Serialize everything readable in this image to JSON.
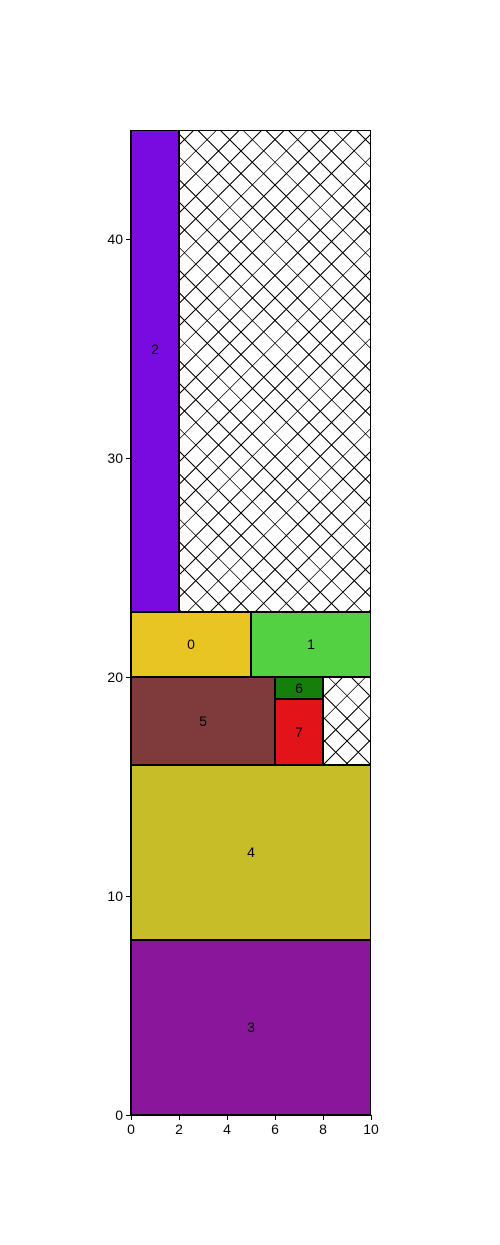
{
  "chart_data": {
    "type": "treemap-rects",
    "xlim": [
      0,
      10
    ],
    "ylim": [
      0,
      45
    ],
    "title": "",
    "xlabel": "",
    "ylabel": "",
    "xticks": [
      0,
      2,
      4,
      6,
      8,
      10
    ],
    "yticks": [
      0,
      10,
      20,
      30,
      40
    ],
    "rects": [
      {
        "id": "0",
        "label": "0",
        "x0": 0,
        "x1": 5,
        "y0": 20,
        "y1": 23,
        "fill": "#e8c522",
        "hatch": false
      },
      {
        "id": "1",
        "label": "1",
        "x0": 5,
        "x1": 10,
        "y0": 20,
        "y1": 23,
        "fill": "#54d043",
        "hatch": false
      },
      {
        "id": "2",
        "label": "2",
        "x0": 0,
        "x1": 2,
        "y0": 23,
        "y1": 45,
        "fill": "#7a0be0",
        "hatch": false
      },
      {
        "id": "h2",
        "label": "",
        "x0": 2,
        "x1": 10,
        "y0": 23,
        "y1": 45,
        "fill": "#ffffff",
        "hatch": true
      },
      {
        "id": "3",
        "label": "3",
        "x0": 0,
        "x1": 10,
        "y0": 0,
        "y1": 8,
        "fill": "#8a169b",
        "hatch": false
      },
      {
        "id": "4",
        "label": "4",
        "x0": 0,
        "x1": 10,
        "y0": 8,
        "y1": 16,
        "fill": "#c7bd29",
        "hatch": false
      },
      {
        "id": "5",
        "label": "5",
        "x0": 0,
        "x1": 6,
        "y0": 16,
        "y1": 20,
        "fill": "#7f3b3b",
        "hatch": false
      },
      {
        "id": "6",
        "label": "6",
        "x0": 6,
        "x1": 8,
        "y0": 19,
        "y1": 20,
        "fill": "#157f0b",
        "hatch": false
      },
      {
        "id": "7",
        "label": "7",
        "x0": 6,
        "x1": 8,
        "y0": 16,
        "y1": 19,
        "fill": "#e2141a",
        "hatch": false
      },
      {
        "id": "h7",
        "label": "",
        "x0": 8,
        "x1": 10,
        "y0": 16,
        "y1": 20,
        "fill": "#ffffff",
        "hatch": true
      }
    ]
  }
}
